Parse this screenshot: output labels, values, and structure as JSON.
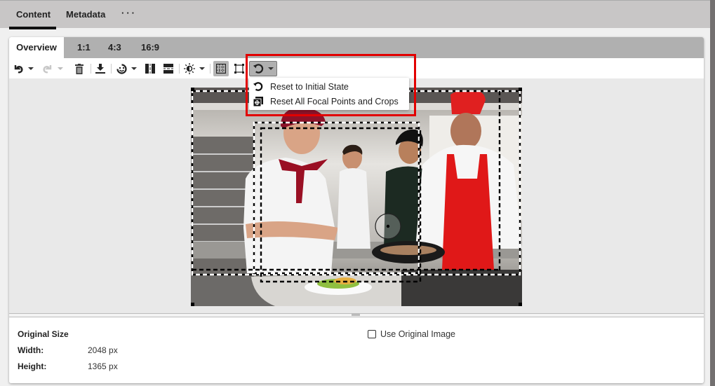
{
  "top_tabs": [
    {
      "label": "Content",
      "active": true
    },
    {
      "label": "Metadata",
      "active": false
    },
    {
      "label": "···",
      "active": false
    }
  ],
  "sub_tabs": [
    {
      "label": "Overview",
      "active": true
    },
    {
      "label": "1:1",
      "active": false
    },
    {
      "label": "4:3",
      "active": false
    },
    {
      "label": "16:9",
      "active": false
    }
  ],
  "toolbar": {
    "icons": [
      "undo-icon",
      "redo-icon",
      "delete-icon",
      "download-icon",
      "face-detect-icon",
      "flip-horizontal-icon",
      "flip-vertical-icon",
      "brightness-icon",
      "crop-grid-icon",
      "crop-frame-icon",
      "reset-icon"
    ]
  },
  "reset_menu": {
    "items": [
      {
        "label": "Reset to Initial State",
        "icon": "reset-icon"
      },
      {
        "label": "Reset All Focal Points and Crops",
        "icon": "focal-point-crops-icon"
      }
    ]
  },
  "info": {
    "title": "Original Size",
    "width_label": "Width:",
    "width_value": "2048 px",
    "height_label": "Height:",
    "height_value": "1365 px",
    "use_original_label": "Use Original Image",
    "use_original_checked": false
  },
  "colors": {
    "highlight": "#e20000",
    "tab_bar": "#c8c6c6",
    "subtab_bar": "#b0b0b0"
  }
}
